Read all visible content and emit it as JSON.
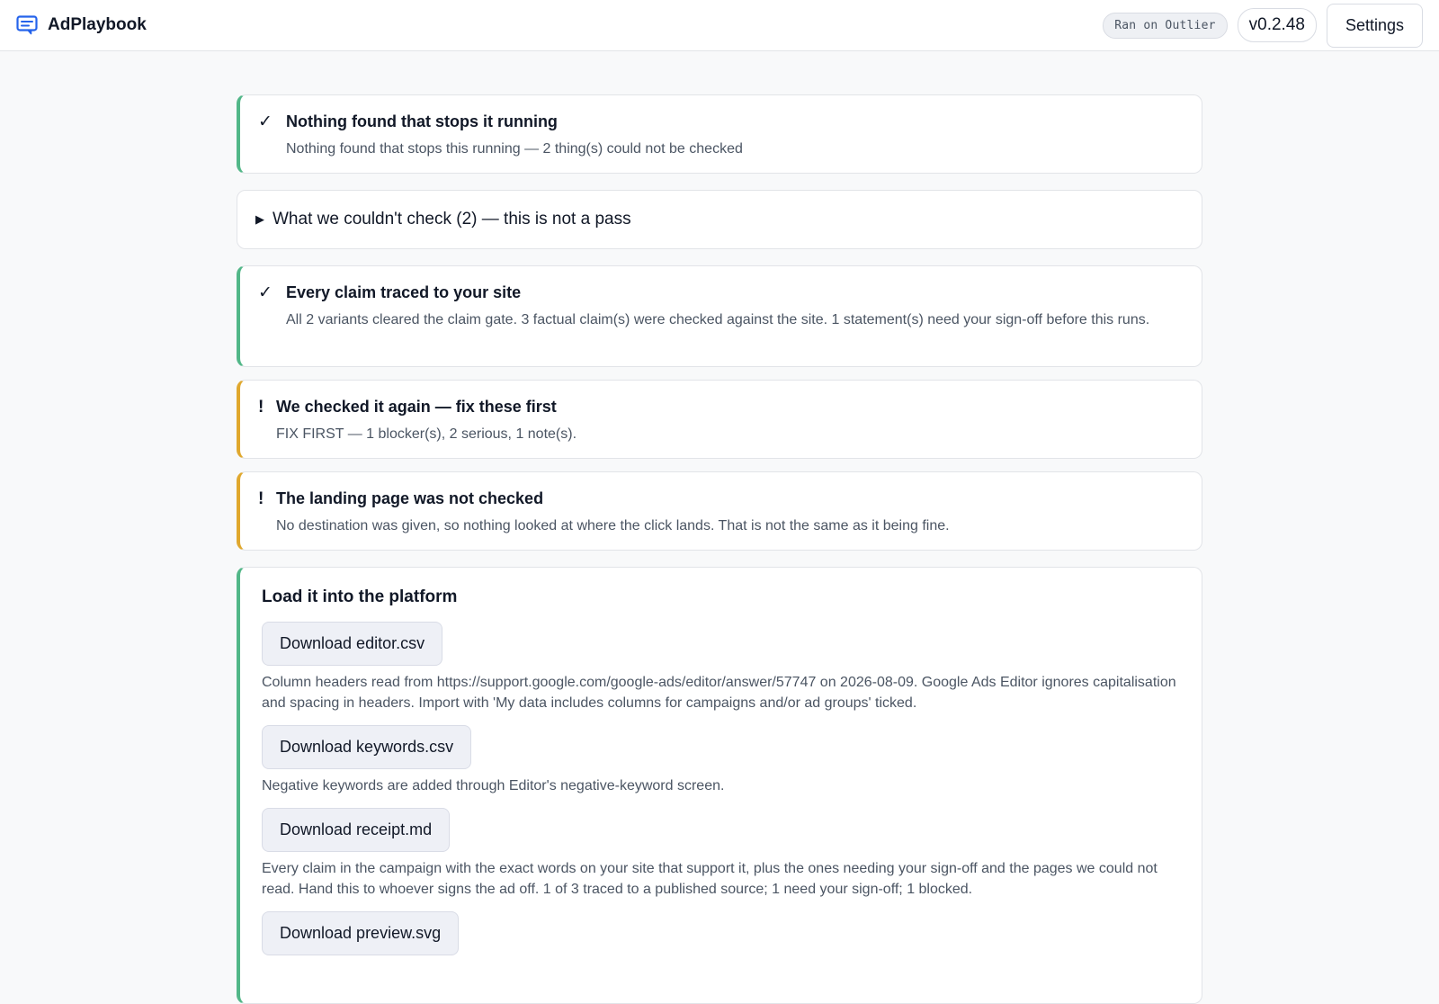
{
  "app": {
    "name": "AdPlaybook",
    "ran_on": "Ran on Outlier",
    "version": "v0.2.48",
    "settings_label": "Settings",
    "accent_color": "#2563eb"
  },
  "checks": [
    {
      "status": "pass",
      "icon": "check-icon",
      "symbol": "✓",
      "title": "Nothing found that stops it running",
      "desc": "Nothing found that stops this running — 2 thing(s) could not be checked"
    },
    {
      "status": "pass",
      "icon": "check-icon",
      "symbol": "✓",
      "title": "Every claim traced to your site",
      "desc": "All 2 variants cleared the claim gate. 3 factual claim(s) were checked against the site. 1 statement(s) need your sign-off before this runs."
    },
    {
      "status": "warn",
      "icon": "warning-icon",
      "symbol": "!",
      "title": "We checked it again — fix these first",
      "desc": "FIX FIRST — 1 blocker(s), 2 serious, 1 note(s)."
    },
    {
      "status": "warn",
      "icon": "warning-icon",
      "symbol": "!",
      "title": "The landing page was not checked",
      "desc": "No destination was given, so nothing looked at where the click lands. That is not the same as it being fine."
    }
  ],
  "unchecked": {
    "icon": "triangle-right-icon",
    "symbol": "▶",
    "label": "What we couldn't check (2) — this is not a pass"
  },
  "platform": {
    "title": "Load it into the platform",
    "downloads": [
      {
        "label": "Download editor.csv",
        "desc": "Column headers read from https://support.google.com/google-ads/editor/answer/57747 on 2026-08-09. Google Ads Editor ignores capitalisation and spacing in headers. Import with 'My data includes columns for campaigns and/or ad groups' ticked."
      },
      {
        "label": "Download keywords.csv",
        "desc": "Negative keywords are added through Editor's negative-keyword screen."
      },
      {
        "label": "Download receipt.md",
        "desc": "Every claim in the campaign with the exact words on your site that support it, plus the ones needing your sign-off and the pages we could not read. Hand this to whoever signs the ad off. 1 of 3 traced to a published source; 1 need your sign-off; 1 blocked."
      },
      {
        "label": "Download preview.svg",
        "desc": ""
      }
    ]
  },
  "colors": {
    "pass_accent": "#52b788",
    "warn_accent": "#e0a82e"
  }
}
